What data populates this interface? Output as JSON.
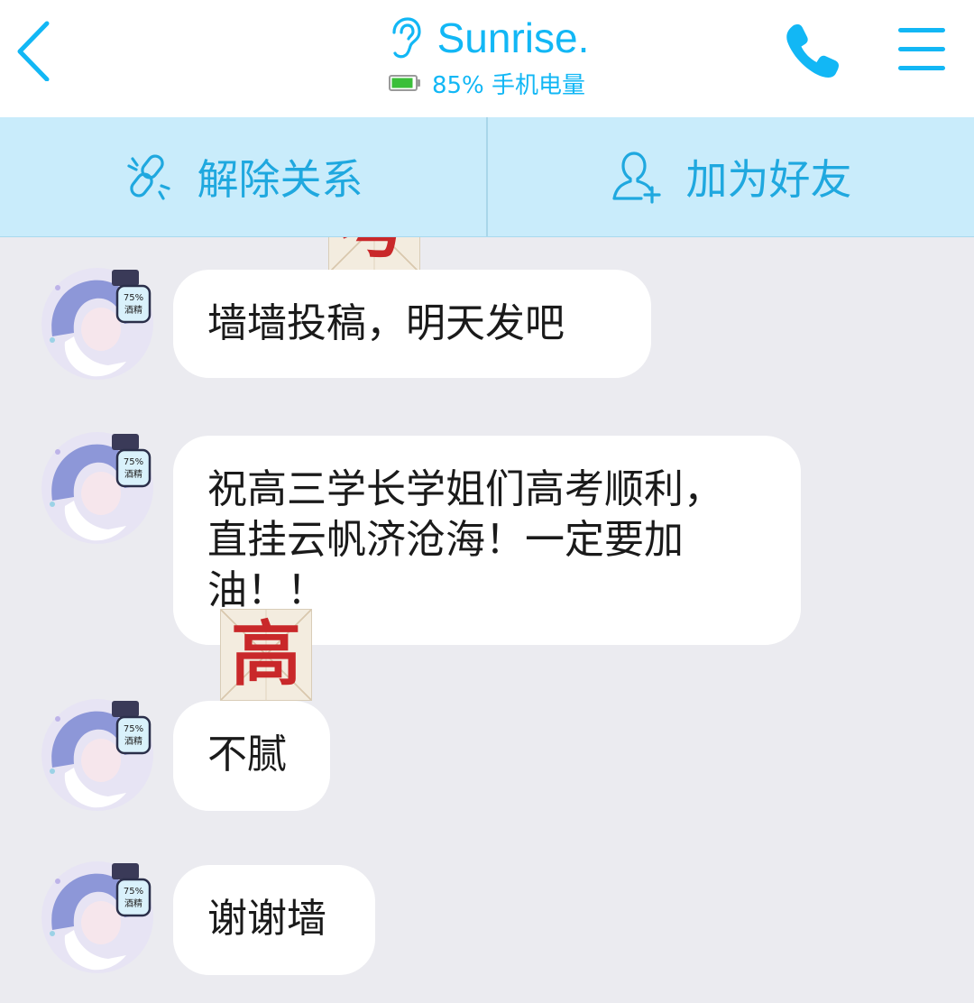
{
  "header": {
    "title": "Sunrise.",
    "battery": "85% 手机电量",
    "battery_color": "#3bbf3a",
    "accent_color": "#12b7f5"
  },
  "actions": [
    {
      "label": "解除关系",
      "icon": "broken-link-icon"
    },
    {
      "label": "加为好友",
      "icon": "add-friend-icon"
    }
  ],
  "stickers": [
    {
      "char": "考"
    },
    {
      "char": "高"
    }
  ],
  "messages": [
    {
      "text": "墙墙投稿，明天发吧"
    },
    {
      "text": "祝高三学长学姐们高考顺利，直挂云帆济沧海！一定要加油！！"
    },
    {
      "text": "不腻"
    },
    {
      "text": "谢谢墙"
    }
  ],
  "avatar": {
    "badge": "75%\n酒精"
  }
}
